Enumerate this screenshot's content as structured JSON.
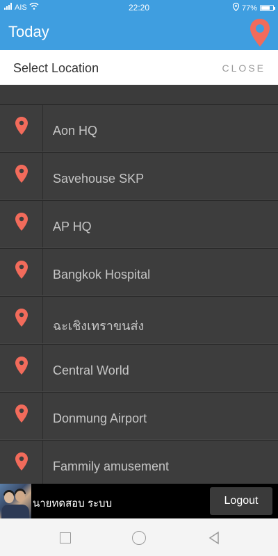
{
  "status_bar": {
    "carrier": "AIS",
    "time": "22:20",
    "battery": "77%",
    "battery_fraction": 0.77
  },
  "app_bar": {
    "title": "Today",
    "pin_icon": "map-pin-icon",
    "pin_color": "#f26b5b"
  },
  "modal": {
    "title": "Select Location",
    "close_label": "CLOSE"
  },
  "locations": [
    {
      "label": "Aon HQ",
      "icon": "map-pin-icon"
    },
    {
      "label": "Savehouse SKP",
      "icon": "map-pin-icon"
    },
    {
      "label": "AP HQ",
      "icon": "map-pin-icon"
    },
    {
      "label": "Bangkok Hospital",
      "icon": "map-pin-icon"
    },
    {
      "label": "ฉะเชิงเทราขนส่ง",
      "icon": "map-pin-icon"
    },
    {
      "label": "Central World",
      "icon": "map-pin-icon"
    },
    {
      "label": "Donmung Airport",
      "icon": "map-pin-icon"
    },
    {
      "label": "Fammily amusement",
      "icon": "map-pin-icon"
    }
  ],
  "user_bar": {
    "name": "นายทดสอบ ระบบ",
    "logout_label": "Logout"
  },
  "nav": {
    "recents": "square-icon",
    "home": "circle-icon",
    "back": "triangle-back-icon"
  },
  "colors": {
    "primary": "#3f9ee0",
    "pin": "#f26b5b",
    "list_bg": "#3b3b3b"
  }
}
